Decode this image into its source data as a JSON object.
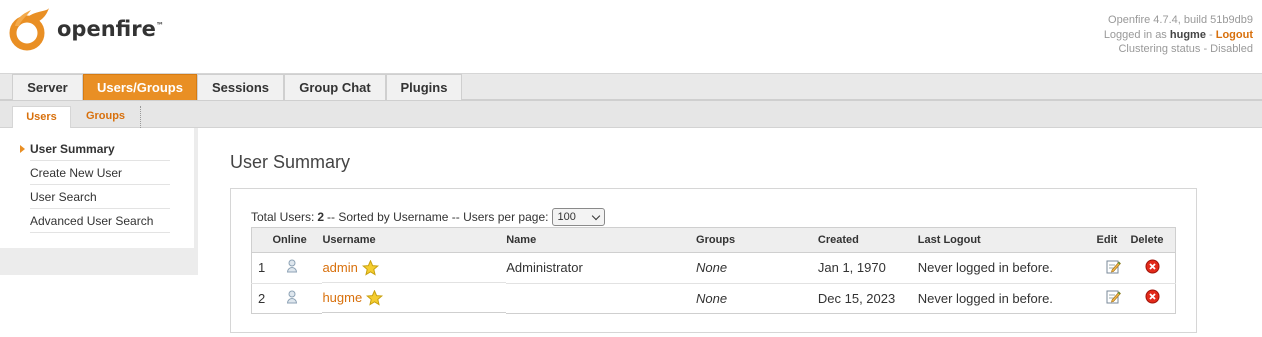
{
  "header": {
    "logo_text": "openfire",
    "version": "Openfire 4.7.4, build 51b9db9",
    "logged_in_prefix": "Logged in as",
    "user": "hugme",
    "separator": "-",
    "logout": "Logout",
    "clustering": "Clustering status - Disabled"
  },
  "tabs": [
    {
      "label": "Server"
    },
    {
      "label": "Users/Groups"
    },
    {
      "label": "Sessions"
    },
    {
      "label": "Group Chat"
    },
    {
      "label": "Plugins"
    }
  ],
  "subtabs": [
    {
      "label": "Users"
    },
    {
      "label": "Groups"
    }
  ],
  "sidebar": {
    "items": [
      {
        "label": "User Summary"
      },
      {
        "label": "Create New User"
      },
      {
        "label": "User Search"
      },
      {
        "label": "Advanced User Search"
      }
    ]
  },
  "main": {
    "title": "User Summary",
    "summary_prefix": "Total Users:",
    "total": "2",
    "summary_suffix": "-- Sorted by Username -- Users per page:",
    "per_page": "100",
    "columns": [
      "Online",
      "Username",
      "Name",
      "Groups",
      "Created",
      "Last Logout",
      "Edit",
      "Delete"
    ],
    "rows": [
      {
        "num": "1",
        "username": "admin",
        "name": "Administrator",
        "groups": "None",
        "created": "Jan 1, 1970",
        "last_logout": "Never logged in before."
      },
      {
        "num": "2",
        "username": "hugme",
        "name": "",
        "groups": "None",
        "created": "Dec 15, 2023",
        "last_logout": "Never logged in before."
      }
    ]
  },
  "colors": {
    "accent": "#e98f24",
    "link": "#d8700c"
  }
}
